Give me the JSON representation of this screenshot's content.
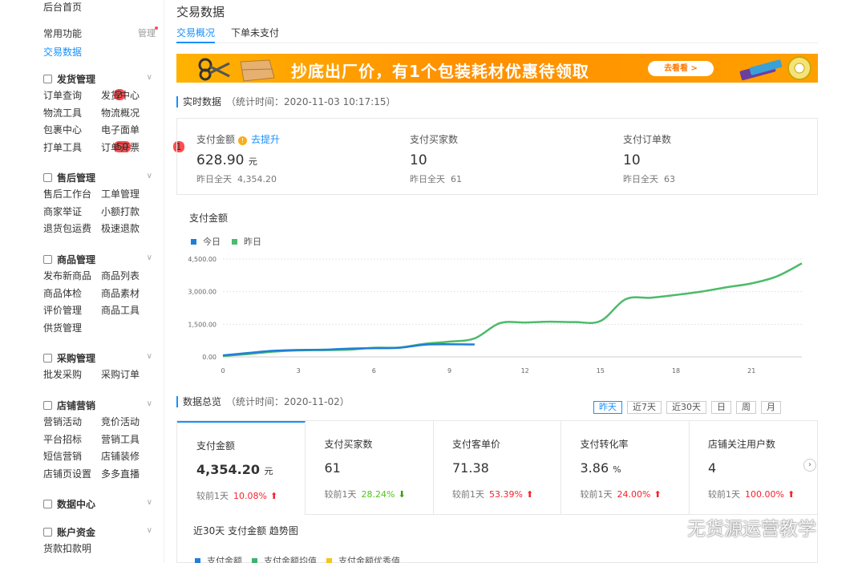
{
  "sidebar": {
    "home": "后台首页",
    "common": {
      "title": "常用功能",
      "manage": "管理"
    },
    "active_link": "交易数据",
    "groups": [
      {
        "title": "发货管理",
        "items": [
          {
            "label": "订单查询",
            "badge": "2"
          },
          {
            "label": "发货中心"
          },
          {
            "label": "物流工具"
          },
          {
            "label": "物流概况"
          },
          {
            "label": "包裹中心"
          },
          {
            "label": "电子面单",
            "dot": true
          },
          {
            "label": "打单工具",
            "badge": "50"
          },
          {
            "label": "订单开票",
            "badge": "1"
          }
        ]
      },
      {
        "title": "售后管理",
        "items": [
          {
            "label": "售后工作台"
          },
          {
            "label": "工单管理"
          },
          {
            "label": "商家举证"
          },
          {
            "label": "小额打款"
          },
          {
            "label": "退货包运费"
          },
          {
            "label": "极速退款"
          }
        ]
      },
      {
        "title": "商品管理",
        "items": [
          {
            "label": "发布新商品"
          },
          {
            "label": "商品列表"
          },
          {
            "label": "商品体检"
          },
          {
            "label": "商品素材"
          },
          {
            "label": "评价管理"
          },
          {
            "label": "商品工具"
          },
          {
            "label": "供货管理"
          }
        ]
      },
      {
        "title": "采购管理",
        "items": [
          {
            "label": "批发采购"
          },
          {
            "label": "采购订单"
          }
        ]
      },
      {
        "title": "店铺营销",
        "items": [
          {
            "label": "营销活动"
          },
          {
            "label": "竞价活动"
          },
          {
            "label": "平台招标",
            "dot": true
          },
          {
            "label": "营销工具"
          },
          {
            "label": "短信营销"
          },
          {
            "label": "店铺装修"
          },
          {
            "label": "店铺页设置"
          },
          {
            "label": "多多直播"
          }
        ]
      },
      {
        "title": "数据中心",
        "items": []
      },
      {
        "title": "账户资金",
        "items": [
          {
            "label": "货款扣款明"
          },
          {
            "label": ""
          }
        ]
      }
    ]
  },
  "main": {
    "title": "交易数据",
    "tabs": [
      "交易概况",
      "下单未支付"
    ],
    "banner": {
      "text": "抄底出厂价，有1个包装耗材优惠待领取",
      "button": "去看看 >"
    },
    "realtime": {
      "heading": "实时数据",
      "stat_time": "（统计时间：2020-11-03 10:17:15）",
      "metrics": [
        {
          "label": "支付金额",
          "link": "去提升",
          "value": "628.90",
          "unit": "元",
          "prev_label": "昨日全天",
          "prev": "4,354.20"
        },
        {
          "label": "支付买家数",
          "value": "10",
          "unit": "",
          "prev_label": "昨日全天",
          "prev": "61"
        },
        {
          "label": "支付订单数",
          "value": "10",
          "unit": "",
          "prev_label": "昨日全天",
          "prev": "63"
        }
      ]
    },
    "overview": {
      "heading": "数据总览",
      "stat_time": "（统计时间：2020-11-02）",
      "ranges": [
        "昨天",
        "近7天",
        "近30天",
        "日",
        "周",
        "月"
      ],
      "active_range": "昨天",
      "cards": [
        {
          "label": "支付金额",
          "value": "4,354.20",
          "unit": "元",
          "cmp_label": "较前1天",
          "pct": "10.08%",
          "dir": "up"
        },
        {
          "label": "支付买家数",
          "value": "61",
          "unit": "",
          "cmp_label": "较前1天",
          "pct": "28.24%",
          "dir": "down"
        },
        {
          "label": "支付客单价",
          "value": "71.38",
          "unit": "",
          "cmp_label": "较前1天",
          "pct": "53.39%",
          "dir": "up"
        },
        {
          "label": "支付转化率",
          "value": "3.86",
          "unit": "%",
          "cmp_label": "较前1天",
          "pct": "24.00%",
          "dir": "up"
        },
        {
          "label": "店铺关注用户数",
          "value": "4",
          "unit": "",
          "cmp_label": "较前1天",
          "pct": "100.00%",
          "dir": "up"
        }
      ],
      "trend_title": "近30天 支付金额 趋势图",
      "trend_legend": [
        {
          "name": "支付金额",
          "color": "#1f7fd8"
        },
        {
          "name": "支付金额均值",
          "color": "#3cb371"
        },
        {
          "name": "支付金额优秀值",
          "color": "#f5c518"
        }
      ]
    },
    "watermark": "无货源运营教学"
  },
  "chart_data": {
    "type": "line",
    "title": "支付金额",
    "series": [
      {
        "name": "今日",
        "color": "#1f7fd8",
        "x": [
          0,
          1,
          2,
          3,
          4,
          5,
          6,
          7,
          8,
          9,
          10
        ],
        "values": [
          70,
          180,
          280,
          320,
          330,
          380,
          400,
          420,
          560,
          580,
          570
        ]
      },
      {
        "name": "昨日",
        "color": "#4cbb6a",
        "x": [
          0,
          1,
          2,
          3,
          4,
          5,
          6,
          7,
          8,
          9,
          10,
          11,
          12,
          13,
          14,
          15,
          16,
          17,
          18,
          19,
          20,
          21,
          22,
          23
        ],
        "values": [
          40,
          130,
          240,
          300,
          310,
          330,
          420,
          430,
          600,
          700,
          850,
          1550,
          1580,
          1620,
          1600,
          1650,
          2650,
          2720,
          2850,
          3000,
          3200,
          3380,
          3700,
          4300
        ]
      }
    ],
    "x_ticks": [
      0,
      3,
      6,
      9,
      12,
      15,
      18,
      21
    ],
    "y_ticks": [
      "0.00",
      "1,500.00",
      "3,000.00",
      "4,500.00"
    ],
    "xlim": [
      0,
      23
    ],
    "ylim": [
      0,
      4500
    ],
    "grid": true,
    "legend": "top-left"
  }
}
